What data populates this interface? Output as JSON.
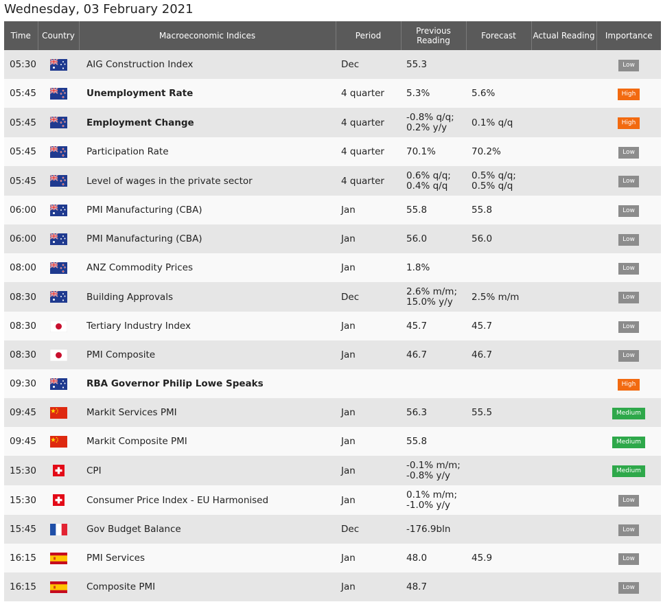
{
  "page": {
    "title": "Wednesday, 03 February 2021"
  },
  "headers": {
    "time": "Time",
    "country": "Country",
    "indices": "Macroeconomic Indices",
    "period": "Period",
    "previous_line1": "Previous",
    "previous_line2": "Reading",
    "forecast": "Forecast",
    "actual": "Actual Reading",
    "importance": "Importance"
  },
  "colors": {
    "low": "#8c8c8c",
    "high": "#f26a10",
    "medium": "#2ea84a",
    "header_bg": "#5a5a5a"
  },
  "rows": [
    {
      "time": "05:30",
      "country": "australia-flag-icon",
      "index": "AIG Construction Index",
      "bold": false,
      "period": "Dec",
      "prev1": "55.3",
      "prev2": "",
      "fc1": "",
      "fc2": "",
      "actual": "",
      "importance": "Low"
    },
    {
      "time": "05:45",
      "country": "new-zealand-flag-icon",
      "index": "Unemployment Rate",
      "bold": true,
      "period": "4 quarter",
      "prev1": "5.3%",
      "prev2": "",
      "fc1": "5.6%",
      "fc2": "",
      "actual": "",
      "importance": "High"
    },
    {
      "time": "05:45",
      "country": "new-zealand-flag-icon",
      "index": "Employment Change",
      "bold": true,
      "period": "4 quarter",
      "prev1": "-0.8% q/q;",
      "prev2": "0.2% y/y",
      "fc1": "0.1% q/q",
      "fc2": "",
      "actual": "",
      "importance": "High"
    },
    {
      "time": "05:45",
      "country": "new-zealand-flag-icon",
      "index": "Participation Rate",
      "bold": false,
      "period": "4 quarter",
      "prev1": "70.1%",
      "prev2": "",
      "fc1": "70.2%",
      "fc2": "",
      "actual": "",
      "importance": "Low"
    },
    {
      "time": "05:45",
      "country": "new-zealand-flag-icon",
      "index": "Level of wages in the private sector",
      "bold": false,
      "period": "4 quarter",
      "prev1": "0.6% q/q;",
      "prev2": "0.4% q/q",
      "fc1": "0.5% q/q;",
      "fc2": "0.5% q/q",
      "actual": "",
      "importance": "Low"
    },
    {
      "time": "06:00",
      "country": "australia-flag-icon",
      "index": "PMI Manufacturing (CBA)",
      "bold": false,
      "period": "Jan",
      "prev1": "55.8",
      "prev2": "",
      "fc1": "55.8",
      "fc2": "",
      "actual": "",
      "importance": "Low"
    },
    {
      "time": "06:00",
      "country": "australia-flag-icon",
      "index": "PMI Manufacturing (CBA)",
      "bold": false,
      "period": "Jan",
      "prev1": "56.0",
      "prev2": "",
      "fc1": "56.0",
      "fc2": "",
      "actual": "",
      "importance": "Low"
    },
    {
      "time": "08:00",
      "country": "new-zealand-flag-icon",
      "index": "ANZ Commodity Prices",
      "bold": false,
      "period": "Jan",
      "prev1": "1.8%",
      "prev2": "",
      "fc1": "",
      "fc2": "",
      "actual": "",
      "importance": "Low"
    },
    {
      "time": "08:30",
      "country": "australia-flag-icon",
      "index": "Building Approvals",
      "bold": false,
      "period": "Dec",
      "prev1": "2.6% m/m;",
      "prev2": "15.0% y/y",
      "fc1": "2.5% m/m",
      "fc2": "",
      "actual": "",
      "importance": "Low"
    },
    {
      "time": "08:30",
      "country": "japan-flag-icon",
      "index": "Tertiary Industry Index",
      "bold": false,
      "period": "Jan",
      "prev1": "45.7",
      "prev2": "",
      "fc1": "45.7",
      "fc2": "",
      "actual": "",
      "importance": "Low"
    },
    {
      "time": "08:30",
      "country": "japan-flag-icon",
      "index": "PMI Composite",
      "bold": false,
      "period": "Jan",
      "prev1": "46.7",
      "prev2": "",
      "fc1": "46.7",
      "fc2": "",
      "actual": "",
      "importance": "Low"
    },
    {
      "time": "09:30",
      "country": "australia-flag-icon",
      "index": "RBA Governor Philip Lowe Speaks",
      "bold": true,
      "period": "",
      "prev1": "",
      "prev2": "",
      "fc1": "",
      "fc2": "",
      "actual": "",
      "importance": "High"
    },
    {
      "time": "09:45",
      "country": "china-flag-icon",
      "index": "Markit Services PMI",
      "bold": false,
      "period": "Jan",
      "prev1": "56.3",
      "prev2": "",
      "fc1": "55.5",
      "fc2": "",
      "actual": "",
      "importance": "Medium"
    },
    {
      "time": "09:45",
      "country": "china-flag-icon",
      "index": "Markit Composite PMI",
      "bold": false,
      "period": "Jan",
      "prev1": "55.8",
      "prev2": "",
      "fc1": "",
      "fc2": "",
      "actual": "",
      "importance": "Medium"
    },
    {
      "time": "15:30",
      "country": "switzerland-flag-icon",
      "index": "CPI",
      "bold": false,
      "period": "Jan",
      "prev1": "-0.1% m/m;",
      "prev2": "-0.8% y/y",
      "fc1": "",
      "fc2": "",
      "actual": "",
      "importance": "Medium"
    },
    {
      "time": "15:30",
      "country": "switzerland-flag-icon",
      "index": "Consumer Price Index - EU Harmonised",
      "bold": false,
      "period": "Jan",
      "prev1": "0.1% m/m;",
      "prev2": "-1.0% y/y",
      "fc1": "",
      "fc2": "",
      "actual": "",
      "importance": "Low"
    },
    {
      "time": "15:45",
      "country": "france-flag-icon",
      "index": "Gov Budget Balance",
      "bold": false,
      "period": "Dec",
      "prev1": "-176.9bln",
      "prev2": "",
      "fc1": "",
      "fc2": "",
      "actual": "",
      "importance": "Low"
    },
    {
      "time": "16:15",
      "country": "spain-flag-icon",
      "index": "PMI Services",
      "bold": false,
      "period": "Jan",
      "prev1": "48.0",
      "prev2": "",
      "fc1": "45.9",
      "fc2": "",
      "actual": "",
      "importance": "Low"
    },
    {
      "time": "16:15",
      "country": "spain-flag-icon",
      "index": "Composite PMI",
      "bold": false,
      "period": "Jan",
      "prev1": "48.7",
      "prev2": "",
      "fc1": "",
      "fc2": "",
      "actual": "",
      "importance": "Low"
    }
  ]
}
